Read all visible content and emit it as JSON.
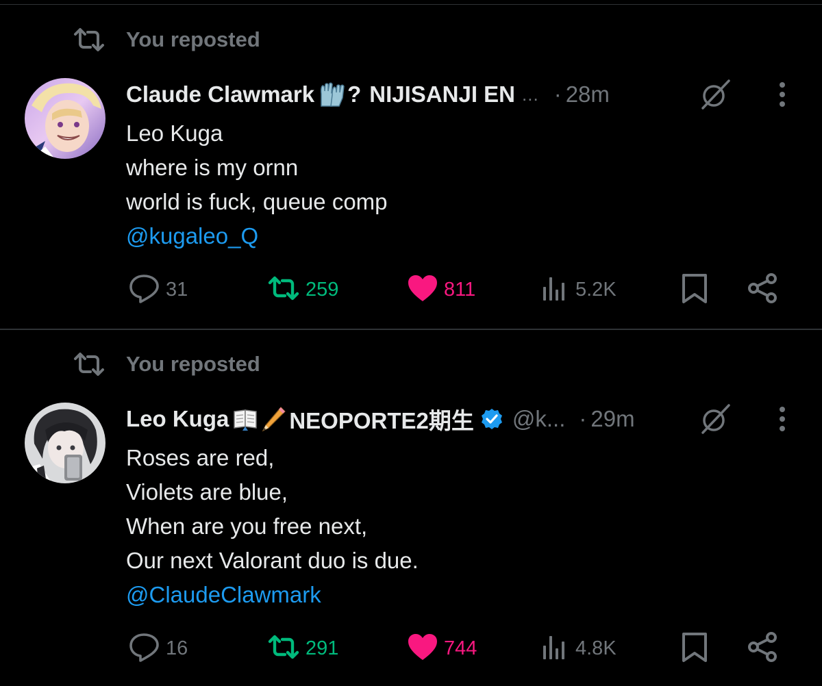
{
  "colors": {
    "background": "#000000",
    "text": "#e7e9ea",
    "muted": "#71767b",
    "link": "#1d9bf0",
    "repost_green": "#00ba7c",
    "like_pink": "#f91880",
    "verified_blue": "#1d9bf0",
    "divider": "#2f3336"
  },
  "posts": [
    {
      "repost_label": "You reposted",
      "repost_icon": "repost-icon",
      "author": {
        "name": "Claude Clawmark",
        "name_emoji": "gloves-emoji",
        "question_mark": "?",
        "suffix": "NIJISANJI EN",
        "ellipsis": "...",
        "handle": "",
        "verified": false
      },
      "separator": "·",
      "time": "28m",
      "body_lines": [
        "Leo Kuga",
        "where is my ornn",
        "world is fuck, queue comp"
      ],
      "mention": "@kugaleo_Q",
      "stats": {
        "replies": "31",
        "reposts": "259",
        "likes": "811",
        "views": "5.2K"
      },
      "reposted_by_me": true,
      "liked_by_me": true
    },
    {
      "repost_label": "You reposted",
      "repost_icon": "repost-icon",
      "author": {
        "name": "Leo Kuga",
        "name_emoji": "book-pencil-emoji",
        "suffix": "NEOPORTE2期生",
        "handle": "@k...",
        "verified": true
      },
      "separator": "·",
      "time": "29m",
      "body_lines": [
        "Roses are red,",
        "Violets are blue,",
        "When are you free next,",
        "Our next Valorant duo is due."
      ],
      "mention": "@ClaudeClawmark",
      "stats": {
        "replies": "16",
        "reposts": "291",
        "likes": "744",
        "views": "4.8K"
      },
      "reposted_by_me": true,
      "liked_by_me": true
    }
  ]
}
